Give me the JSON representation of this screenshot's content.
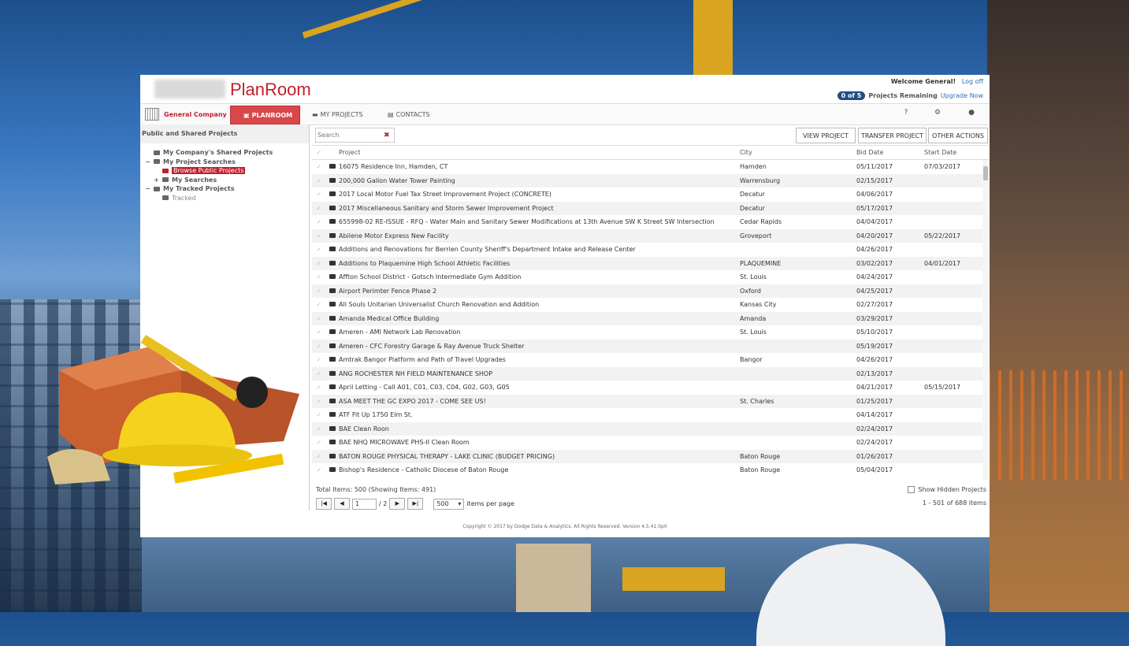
{
  "colors": {
    "brand": "#c0202d",
    "accent": "#1f4e86",
    "active_tab": "#d9474b",
    "link": "#2a6fb5"
  },
  "header": {
    "brand": "PlanRoom",
    "welcome": "Welcome General!",
    "logoff": "Log off",
    "remaining_pill": "0 of 5",
    "remaining_text": "Projects Remaining",
    "upgrade": "Upgrade Now"
  },
  "nav": {
    "company": "General Company",
    "tabs": [
      {
        "label": "PLANROOM",
        "icon": "planroom-icon"
      },
      {
        "label": "MY PROJECTS",
        "icon": "briefcase-icon"
      },
      {
        "label": "CONTACTS",
        "icon": "contacts-icon"
      }
    ],
    "right_icons": [
      "help-icon",
      "settings-icon",
      "user-icon"
    ],
    "help_glyph": "?"
  },
  "sidebar": {
    "title": "Public and Shared Projects",
    "tree": [
      {
        "label": "My Company's Shared Projects",
        "toggle": "",
        "level": 1
      },
      {
        "label": "My Project Searches",
        "toggle": "−",
        "level": 1
      },
      {
        "label": "Browse Public Projects",
        "toggle": "",
        "level": 2,
        "selected": true
      },
      {
        "label": "My Searches",
        "toggle": "+",
        "level": 2
      },
      {
        "label": "My Tracked Projects",
        "toggle": "−",
        "level": 1
      },
      {
        "label": "Tracked",
        "toggle": "",
        "level": 2,
        "dim": true
      }
    ]
  },
  "toolbar": {
    "search_placeholder": "Search",
    "clear": "✖",
    "view_project": "VIEW PROJECT",
    "transfer_project": "TRANSFER PROJECT",
    "other_actions": "OTHER ACTIONS"
  },
  "grid": {
    "columns": [
      "Project",
      "City",
      "Bid Date",
      "Start Date"
    ],
    "rows": [
      [
        "16075 Residence Inn, Hamden, CT",
        "Hamden",
        "05/11/2017",
        "07/03/2017"
      ],
      [
        "200,000 Gallon Water Tower Painting",
        "Warrensburg",
        "02/15/2017",
        ""
      ],
      [
        "2017 Local Motor Fuel Tax Street Improvement Project (CONCRETE)",
        "Decatur",
        "04/06/2017",
        ""
      ],
      [
        "2017 Miscellaneous Sanitary and Storm Sewer Improvement Project",
        "Decatur",
        "05/17/2017",
        ""
      ],
      [
        "655998-02 RE-ISSUE - RFQ - Water Main and Sanitary Sewer Modifications at 13th Avenue SW K Street SW Intersection",
        "Cedar Rapids",
        "04/04/2017",
        ""
      ],
      [
        "Abilene Motor Express New Facility",
        "Groveport",
        "04/20/2017",
        "05/22/2017"
      ],
      [
        "Additions and Renovations for Berrien County Sheriff's Department Intake and Release Center",
        "",
        "04/26/2017",
        ""
      ],
      [
        "Additions to Plaquemine High School Athletic Facilities",
        "PLAQUEMINE",
        "03/02/2017",
        "04/01/2017"
      ],
      [
        "Affton School District - Gotsch Intermediate Gym Addition",
        "St. Louis",
        "04/24/2017",
        ""
      ],
      [
        "Airport Perimter Fence Phase 2",
        "Oxford",
        "04/25/2017",
        ""
      ],
      [
        "All Souls Unitarian Universalist Church Renovation and Addition",
        "Kansas City",
        "02/27/2017",
        ""
      ],
      [
        "Amanda Medical Office Building",
        "Amanda",
        "03/29/2017",
        ""
      ],
      [
        "Ameren - AMI Network Lab Renovation",
        "St. Louis",
        "05/10/2017",
        ""
      ],
      [
        "Ameren - CFC Forestry Garage & Ray Avenue Truck Shelter",
        "",
        "05/19/2017",
        ""
      ],
      [
        "Amtrak Bangor Platform and Path of Travel Upgrades",
        "Bangor",
        "04/26/2017",
        ""
      ],
      [
        "ANG ROCHESTER NH FIELD MAINTENANCE SHOP",
        "",
        "02/13/2017",
        ""
      ],
      [
        "April Letting - Call A01, C01, C03, C04, G02, G03, G05",
        "",
        "04/21/2017",
        "05/15/2017"
      ],
      [
        "ASA MEET THE GC EXPO 2017 - COME SEE US!",
        "St. Charles",
        "01/25/2017",
        ""
      ],
      [
        "ATF Fit Up 1750 Elm St.",
        "",
        "04/14/2017",
        ""
      ],
      [
        "BAE Clean Roon",
        "",
        "02/24/2017",
        ""
      ],
      [
        "BAE NHQ MICROWAVE PHS-II Clean Room",
        "",
        "02/24/2017",
        ""
      ],
      [
        "BATON ROUGE PHYSICAL THERAPY - LAKE CLINIC (BUDGET PRICING)",
        "Baton Rouge",
        "01/26/2017",
        ""
      ],
      [
        "Bishop's Residence - Catholic Diocese of Baton Rouge",
        "Baton Rouge",
        "05/04/2017",
        ""
      ]
    ]
  },
  "footer": {
    "total": "Total Items: 500 (Showing Items: 491)",
    "show_hidden": "Show Hidden Projects",
    "page_value": "1",
    "page_of": "/ 2",
    "per_page_value": "500",
    "per_page_label": "items per page",
    "range": "1 - 501 of 688 items",
    "first": "|◀",
    "prev": "◀",
    "next": "▶",
    "last": "▶|"
  },
  "copyright": "Copyright © 2017 by Dodge Data & Analytics. All Rights Reserved. Version 4.5.41.0p0"
}
